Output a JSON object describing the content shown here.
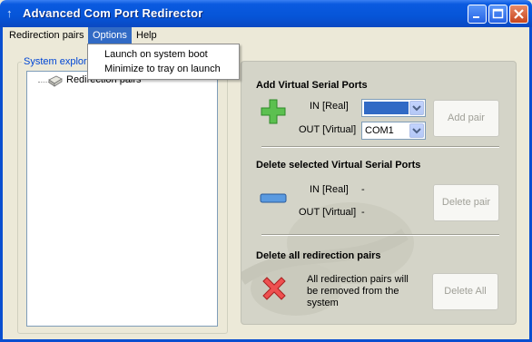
{
  "window": {
    "title": "Advanced Com Port Redirector",
    "icon": "app-icon"
  },
  "menubar": {
    "items": [
      {
        "label": "Redirection pairs"
      },
      {
        "label": "Options"
      },
      {
        "label": "Help"
      }
    ]
  },
  "options_menu": {
    "items": [
      {
        "label": "Launch on system boot"
      },
      {
        "label": "Minimize to tray on launch"
      }
    ]
  },
  "explorer": {
    "legend": "System explorer",
    "tree_root": "Redirection pairs"
  },
  "add_section": {
    "title": "Add Virtual Serial Ports",
    "in_label": "IN [Real]",
    "in_value": "",
    "out_label": "OUT [Virtual]",
    "out_value": "COM1",
    "button": "Add pair"
  },
  "delete_section": {
    "title": "Delete selected Virtual Serial Ports",
    "in_label": "IN [Real]",
    "in_value": "-",
    "out_label": "OUT [Virtual]",
    "out_value": "-",
    "button": "Delete pair"
  },
  "delete_all_section": {
    "title": "Delete all redirection pairs",
    "message_lines": [
      "All redirection pairs will",
      "be removed from the",
      "system"
    ],
    "button": "Delete All"
  },
  "colors": {
    "titlebar": "#0655d8",
    "menu_highlight": "#316ac5",
    "add_icon": "#3cb043",
    "delete_icon": "#4a86d8",
    "delete_all_icon": "#e04040"
  }
}
